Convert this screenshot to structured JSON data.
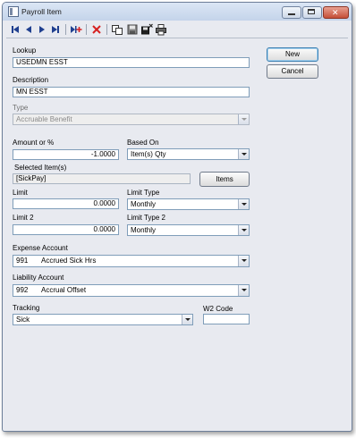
{
  "window": {
    "title": "Payroll Item"
  },
  "toolbar": {
    "icons": [
      "first-record-icon",
      "previous-record-icon",
      "next-record-icon",
      "last-record-icon",
      "add-record-icon",
      "delete-record-icon",
      "copy-icon",
      "save-icon",
      "save-close-icon",
      "print-icon"
    ]
  },
  "form": {
    "lookup": {
      "label": "Lookup",
      "value": "USEDMN ESST"
    },
    "description": {
      "label": "Description",
      "value": "MN ESST"
    },
    "type": {
      "label": "Type",
      "value": "Accruable Benefit"
    },
    "amount": {
      "label": "Amount or %",
      "value": "-1.0000"
    },
    "based_on": {
      "label": "Based On",
      "value": "Item(s) Qty"
    },
    "selected_items": {
      "label": "Selected Item(s)",
      "value": "[SickPay]",
      "button": "Items"
    },
    "limit": {
      "label": "Limit",
      "value": "0.0000"
    },
    "limit_type": {
      "label": "Limit Type",
      "value": "Monthly"
    },
    "limit2": {
      "label": "Limit 2",
      "value": "0.0000"
    },
    "limit_type2": {
      "label": "Limit Type 2",
      "value": "Monthly"
    },
    "expense_account": {
      "label": "Expense Account",
      "code": "991",
      "name": "Accrued Sick Hrs"
    },
    "liability_account": {
      "label": "Liability Account",
      "code": "992",
      "name": "Accrual Offset"
    },
    "tracking": {
      "label": "Tracking",
      "value": "Sick"
    },
    "w2_code": {
      "label": "W2 Code",
      "value": ""
    }
  },
  "buttons": {
    "new": "New",
    "cancel": "Cancel"
  },
  "colors": {
    "window_bg": "#e8eaf0",
    "field_border": "#7f9db9",
    "close_button": "#c44f38",
    "delete_icon": "#d62020"
  }
}
